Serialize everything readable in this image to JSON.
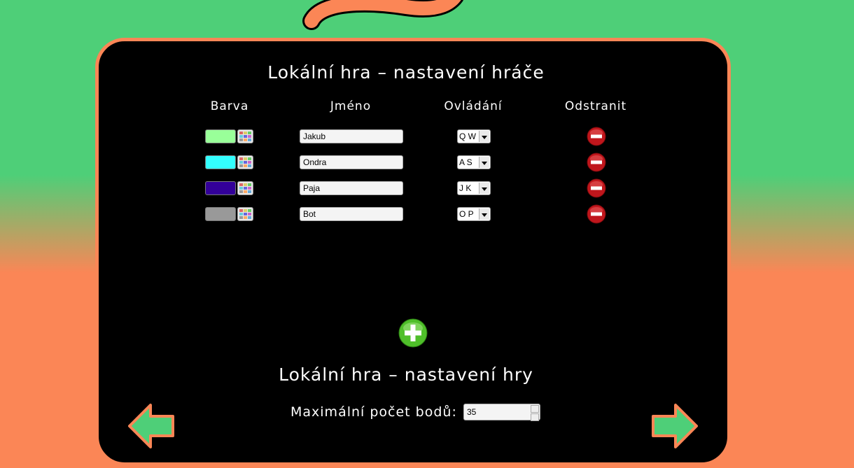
{
  "player_settings": {
    "title": "Lokální hra – nastavení hráče",
    "headers": {
      "color": "Barva",
      "name": "Jméno",
      "controls": "Ovládání",
      "remove": "Odstranit"
    },
    "players": [
      {
        "color": "#99ff99",
        "name": "Jakub",
        "controls": "Q W"
      },
      {
        "color": "#33ffff",
        "name": "Ondra",
        "controls": "A S"
      },
      {
        "color": "#330099",
        "name": "Paja",
        "controls": "J K"
      },
      {
        "color": "#999999",
        "name": "Bot",
        "controls": "O P"
      }
    ]
  },
  "game_settings": {
    "title": "Lokální hra – nastavení hry",
    "max_points_label": "Maximální počet bodů:",
    "max_points_value": "35"
  },
  "colors": {
    "green": "#4ecf78",
    "orange": "#fb8656",
    "panel": "#000000",
    "remove": "#c0161c",
    "add": "#4fbf2a"
  },
  "icons": {
    "palette": "palette-icon",
    "remove": "minus-circle-icon",
    "add": "plus-circle-icon",
    "back": "arrow-left-icon",
    "next": "arrow-right-icon"
  }
}
